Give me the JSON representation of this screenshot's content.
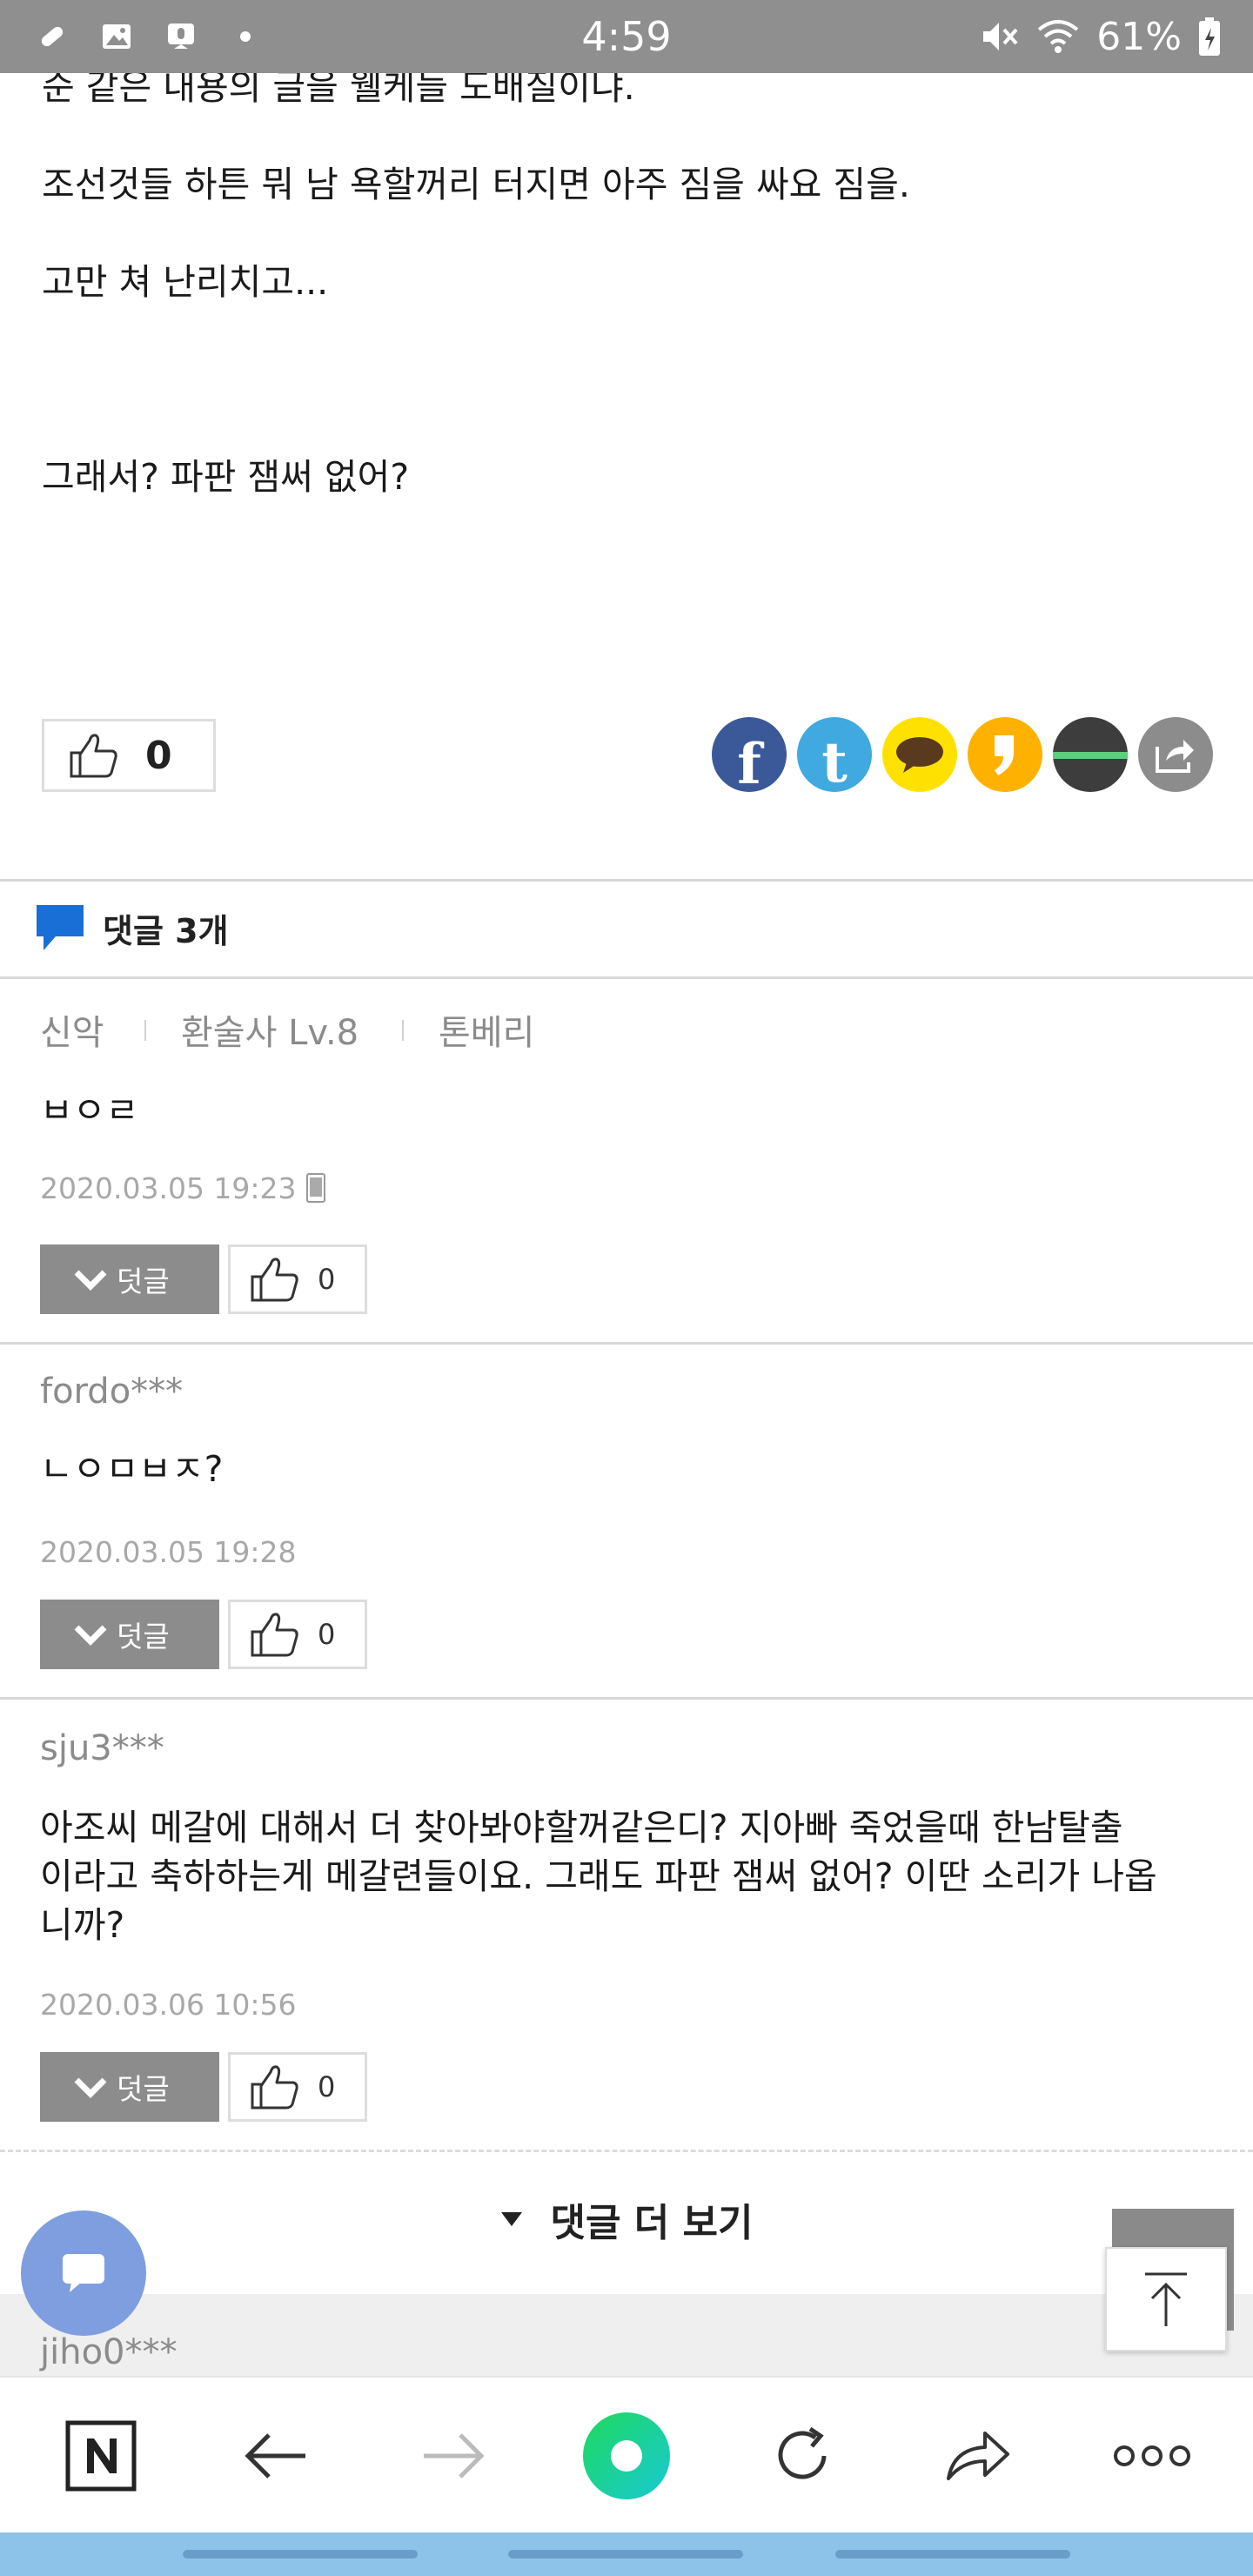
{
  "status_bar": {
    "time": "4:59",
    "battery": "61%",
    "left_icons": [
      "pill-icon",
      "image-icon",
      "voicemail-icon",
      "dot-icon"
    ],
    "right_icons": [
      "mute-icon",
      "wifi-icon",
      "battery-icon"
    ]
  },
  "article": {
    "lines": [
      "순 같은 내용의 글을 웰케들 도배질이냐.",
      "조선것들 하튼 뭐 남 욕할꺼리 터지면 아주 짐을 싸요 짐을.",
      "고만 쳐 난리치고...",
      "그래서? 파판 잼써 없어?"
    ],
    "like_count": "0"
  },
  "share": {
    "facebook_label": "f",
    "twitter_label": "t",
    "colors": {
      "facebook": "#3b5998",
      "twitter": "#3fa9e0",
      "kakaotalk": "#ffe100",
      "kakaostory": "#ffb100",
      "band": "#3d3d3d",
      "more": "#8c8c8c"
    }
  },
  "comments_header": {
    "label": "댓글 3개"
  },
  "comments": [
    {
      "user": "신악",
      "level": "환술사 Lv.8",
      "server": "톤베리",
      "text": "ㅂㅇㄹ",
      "date": "2020.03.05 19:23",
      "reply_label": "덧글",
      "likes": "0"
    },
    {
      "user": "fordo***",
      "text": "ㄴㅇㅁㅂㅈ?",
      "date": "2020.03.05 19:28",
      "reply_label": "덧글",
      "likes": "0"
    },
    {
      "user": "sju3***",
      "text_lines": [
        "아조씨 메갈에 대해서 더 찾아봐야할꺼같은디? 지아빠 죽었을때 한남탈출",
        "이라고 축하하는게 메갈련들이요. 그래도 파판 잼써 없어? 이딴 소리가 나옵",
        "니까?"
      ],
      "date": "2020.03.06 10:56",
      "reply_label": "덧글",
      "likes": "0"
    }
  ],
  "more_comments": {
    "label": "댓글 더 보기"
  },
  "next_comment_user": "jiho0***",
  "bottom_nav": {
    "items": [
      "naver-home-icon",
      "back-arrow-icon",
      "forward-arrow-icon",
      "green-dot-icon",
      "refresh-icon",
      "share-arrow-icon",
      "more-dots-icon"
    ]
  }
}
